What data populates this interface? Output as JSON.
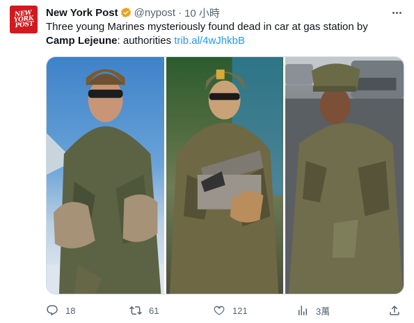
{
  "author": {
    "name": "New York Post",
    "handle": "@nypost",
    "separator": "·",
    "time": "10 小時",
    "avatar_text": [
      "NEW",
      "YORK",
      "POST"
    ],
    "verified_color": "#e8a316"
  },
  "tweet": {
    "text_part1": "Three young Marines mysteriously found dead in car at gas station by ",
    "text_bold": "Camp Lejeune",
    "text_part2": ": authorities ",
    "link": "trib.al/4wJhkbB"
  },
  "metrics": {
    "replies": "18",
    "retweets": "61",
    "likes": "121",
    "views": "3萬"
  },
  "colors": {
    "accent": "#1d9bf0",
    "secondary_text": "#536471",
    "brand_red": "#d11a1f"
  },
  "icons": [
    "more-icon",
    "reply-icon",
    "retweet-icon",
    "like-icon",
    "views-icon",
    "share-icon",
    "verified-badge-icon"
  ]
}
